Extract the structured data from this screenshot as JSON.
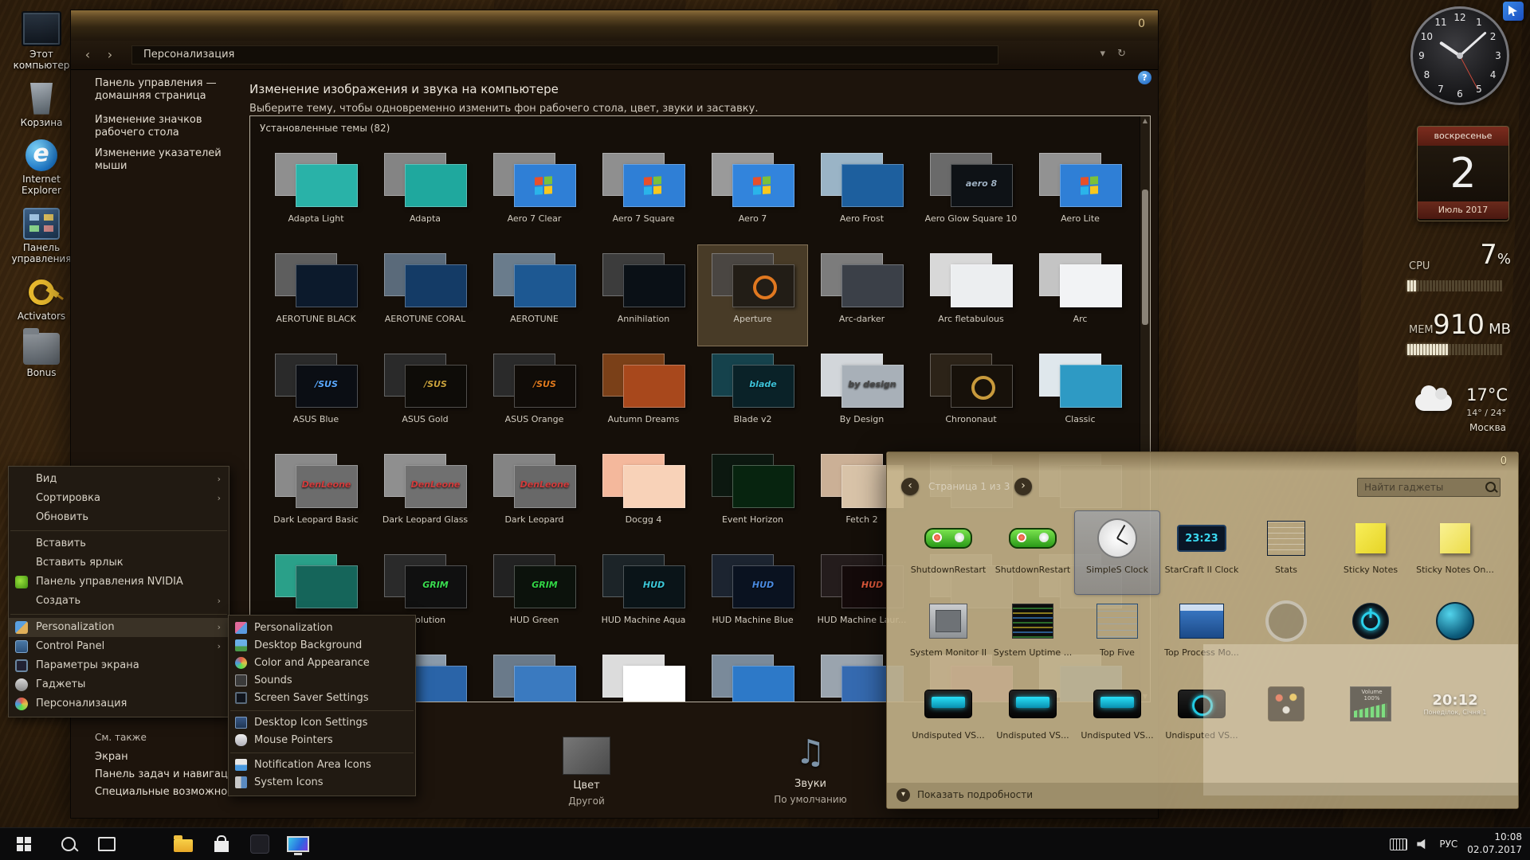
{
  "icons": {
    "back": "‹",
    "forward": "›",
    "dropdown": "▾",
    "refresh": "↻",
    "pager_prev": "‹",
    "pager_next": "›",
    "menu_arrow": "›",
    "expand": "▾",
    "scroll_up": "▲",
    "scroll_down": "▼"
  },
  "desktop_icons": [
    {
      "id": "computer",
      "label": "Этот компьютер"
    },
    {
      "id": "recycle",
      "label": "Корзина"
    },
    {
      "id": "ie",
      "label": "Internet Explorer"
    },
    {
      "id": "control",
      "label": "Панель управления"
    },
    {
      "id": "activators",
      "label": "Activators"
    },
    {
      "id": "bonus",
      "label": "Bonus"
    }
  ],
  "window": {
    "badge": "0",
    "help_badge": "?",
    "toolbar": {
      "address": "Персонализация"
    },
    "sidebar": {
      "home_lines": [
        "Панель управления —",
        "домашняя страница"
      ],
      "links": [
        "Изменение значков рабочего стола",
        "Изменение указателей мыши"
      ],
      "see_also_title": "См. также",
      "see_also": [
        "Экран",
        "Панель задач и навигация",
        "Специальные возможности"
      ]
    },
    "heading": "Изменение изображения и звука на компьютере",
    "subheading": "Выберите тему, чтобы одновременно изменить фон рабочего стола, цвет, звуки и заставку.",
    "themes_label": "Установленные темы (82)",
    "themes": [
      {
        "name": "Adapta Light",
        "back": "#8f8f8f",
        "front": "#29b2a8"
      },
      {
        "name": "Adapta",
        "back": "#848484",
        "front": "#1fa89e"
      },
      {
        "name": "Aero 7 Clear",
        "back": "#8a8a8a",
        "front": "#2f7fd6",
        "flag": true
      },
      {
        "name": "Aero 7 Square",
        "back": "#8f8f8f",
        "front": "#2f7fd6",
        "flag": true
      },
      {
        "name": "Aero 7",
        "back": "#9a9a9a",
        "front": "#3284dc",
        "flag": true
      },
      {
        "name": "Aero Frost",
        "back": "#9ab4c6",
        "front": "#1d5f9e"
      },
      {
        "name": "Aero Glow Square 10",
        "back": "#6a6a6a",
        "front": "#0e1216",
        "tag": "aero 8",
        "tagc": "#9fb2c4"
      },
      {
        "name": "Aero Lite",
        "back": "#929292",
        "front": "#2f7fd6",
        "flag": true
      },
      {
        "name": "AEROTUNE BLACK",
        "back": "#5e5e5e",
        "front": "#0c1a2c"
      },
      {
        "name": "AEROTUNE CORAL",
        "back": "#5a6a7a",
        "front": "#143b66"
      },
      {
        "name": "AEROTUNE",
        "back": "#6a7c8c",
        "front": "#1d5892"
      },
      {
        "name": "Annihilation",
        "back": "#3c3c3c",
        "front": "#0a1016"
      },
      {
        "name": "Aperture",
        "back": "#4a4642",
        "front": "#221d16",
        "ring": "#e07820",
        "selected": true
      },
      {
        "name": "Arc-darker",
        "back": "#7c7c7c",
        "front": "#3b4048"
      },
      {
        "name": "Arc fletabulous",
        "back": "#d8d8d8",
        "front": "#eceef0"
      },
      {
        "name": "Arc",
        "back": "#c4c4c4",
        "front": "#f2f3f5"
      },
      {
        "name": "ASUS Blue",
        "back": "#2a2a2a",
        "front": "#0b0e14",
        "tag": "/SUS",
        "tagc": "#5aa8ff"
      },
      {
        "name": "ASUS Gold",
        "back": "#2a2a2a",
        "front": "#0e0c08",
        "tag": "/SUS",
        "tagc": "#c9a23c"
      },
      {
        "name": "ASUS Orange",
        "back": "#2a2a2a",
        "front": "#100c08",
        "tag": "/SUS",
        "tagc": "#e07a1e"
      },
      {
        "name": "Autumn Dreams",
        "back": "#7a4018",
        "front": "#a8481c"
      },
      {
        "name": "Blade v2",
        "back": "#15424c",
        "front": "#0a2228",
        "tag": "blade",
        "tagc": "#3cc2d8"
      },
      {
        "name": "By Design",
        "back": "#d2d6da",
        "front": "#a8b0b8",
        "tag": "by design",
        "tagc": "#4a4a4a"
      },
      {
        "name": "Chrononaut",
        "back": "#2c2318",
        "front": "#17110a",
        "ring": "#c89a3c"
      },
      {
        "name": "Classic",
        "back": "#dfe7ec",
        "front": "#2e9ac4"
      },
      {
        "name": "Dark Leopard Basic",
        "back": "#8a8a8a",
        "front": "#6c6c6c",
        "tag": "DenLeone",
        "tagc": "#d23c3c"
      },
      {
        "name": "Dark Leopard Glass",
        "back": "#8f8f8f",
        "front": "#707070",
        "tag": "DenLeone",
        "tagc": "#d23c3c"
      },
      {
        "name": "Dark Leopard",
        "back": "#848484",
        "front": "#686868",
        "tag": "DenLeone",
        "tagc": "#d23c3c"
      },
      {
        "name": "Docgg 4",
        "back": "#f4b89c",
        "front": "#f8d2b8"
      },
      {
        "name": "Event Horizon",
        "back": "#0c1810",
        "front": "#07240f"
      },
      {
        "name": "Fetch 2",
        "back": "#cbb096",
        "front": "#d8c3a8"
      },
      {
        "name": "",
        "back": "#5a5a5a",
        "front": "#434343"
      },
      {
        "name": "",
        "back": "#5a5a5a",
        "front": "#434343"
      },
      {
        "name": "",
        "back": "#2aa089",
        "front": "#15655a"
      },
      {
        "name": "Evolution",
        "back": "#2a2a2a",
        "front": "#101010",
        "tag": "GRIM",
        "tagc": "#3adc50"
      },
      {
        "name": "HUD Green",
        "back": "#222222",
        "front": "#0c120c",
        "tag": "GRIM",
        "tagc": "#32d546"
      },
      {
        "name": "HUD Machine Aqua",
        "back": "#1c2428",
        "front": "#0a1418",
        "tag": "HUD",
        "tagc": "#3cc8d8"
      },
      {
        "name": "HUD Machine Blue",
        "back": "#1c2430",
        "front": "#0a1220",
        "tag": "HUD",
        "tagc": "#4a8ae0"
      },
      {
        "name": "HUD Machine Laur...",
        "back": "#241c1c",
        "front": "#140a0a",
        "tag": "HUD",
        "tagc": "#e05a3c"
      },
      {
        "name": "",
        "back": "#5a5a5a",
        "front": "#434343"
      },
      {
        "name": "",
        "back": "#5a5a5a",
        "front": "#434343"
      }
    ],
    "themes_partial": [
      {
        "back": "#7a8a9a",
        "front": "#2f6eb4"
      },
      {
        "back": "#8a9aaa",
        "front": "#2a64a8"
      },
      {
        "back": "#6a7a8a",
        "front": "#3a7ac0"
      },
      {
        "back": "#dcdcdc",
        "front": "#ffffff"
      },
      {
        "back": "#7a8a9a",
        "front": "#2d79c8"
      },
      {
        "back": "#9aa4ae",
        "front": "#356ab0"
      },
      {
        "back": "#9a7a8a",
        "front": "#b05a8a"
      },
      {
        "back": "#8a9aa4",
        "front": "#4a90d9"
      }
    ],
    "footer_items": [
      {
        "label": "Цвет",
        "value": "Другой",
        "icon": "color"
      },
      {
        "label": "Звуки",
        "value": "По умолчанию",
        "icon": "sound"
      }
    ]
  },
  "context_menu": {
    "items": [
      {
        "label": "Вид",
        "arrow": true
      },
      {
        "label": "Сортировка",
        "arrow": true
      },
      {
        "label": "Обновить",
        "sep_after": true
      },
      {
        "label": "Вставить"
      },
      {
        "label": "Вставить ярлык"
      },
      {
        "label": "Панель управления NVIDIA",
        "icon": "nvidia"
      },
      {
        "label": "Создать",
        "arrow": true,
        "sep_after": true
      },
      {
        "label": "Personalization",
        "arrow": true,
        "icon": "pers",
        "highlight": true
      },
      {
        "label": "Control Panel",
        "arrow": true,
        "icon": "cp"
      },
      {
        "label": "Параметры экрана",
        "icon": "display"
      },
      {
        "label": "Гаджеты",
        "icon": "gadgets"
      },
      {
        "label": "Персонализация",
        "icon": "paint"
      }
    ]
  },
  "submenu": {
    "items": [
      {
        "label": "Personalization",
        "icon": "pers"
      },
      {
        "label": "Desktop Background",
        "icon": "bg"
      },
      {
        "label": "Color and Appearance",
        "icon": "color"
      },
      {
        "label": "Sounds",
        "icon": "sound"
      },
      {
        "label": "Screen Saver Settings",
        "icon": "saver",
        "sep_after": true
      },
      {
        "label": "Desktop Icon Settings",
        "icon": "deskicons"
      },
      {
        "label": "Mouse Pointers",
        "icon": "mouse",
        "sep_after": true
      },
      {
        "label": "Notification Area Icons",
        "icon": "notif"
      },
      {
        "label": "System Icons",
        "icon": "sysicons"
      }
    ]
  },
  "gadgets_window": {
    "badge": "0",
    "pager": "Страница 1 из 3",
    "search_placeholder": "Найти гаджеты",
    "footer": "Показать подробности",
    "gadgets": [
      {
        "type": "shutdown",
        "label": "ShutdownRestart"
      },
      {
        "type": "shutdown",
        "label": "ShutdownRestart"
      },
      {
        "type": "clock-simple",
        "label": "SimpleS Clock",
        "selected": true
      },
      {
        "type": "sc2",
        "label": "StarCraft II Clock",
        "text": "23:23"
      },
      {
        "type": "stats",
        "label": "Stats"
      },
      {
        "type": "note",
        "label": "Sticky Notes"
      },
      {
        "type": "note2",
        "label": "Sticky Notes On..."
      },
      {
        "type": "chip",
        "label": "System Monitor II"
      },
      {
        "type": "uptime",
        "label": "System Uptime ..."
      },
      {
        "type": "topfive",
        "label": "Top Five"
      },
      {
        "type": "topproc",
        "label": "Top Process Mo..."
      },
      {
        "type": "clock-gray",
        "label": ""
      },
      {
        "type": "power",
        "label": ""
      },
      {
        "type": "globe",
        "label": ""
      },
      {
        "type": "vs",
        "label": "Undisputed VS..."
      },
      {
        "type": "vs",
        "label": "Undisputed VS..."
      },
      {
        "type": "vs",
        "label": "Undisputed VS..."
      },
      {
        "type": "vs-wifi",
        "label": "Undisputed VS..."
      },
      {
        "type": "tools",
        "label": ""
      },
      {
        "type": "volume",
        "label": "",
        "text": "Volume 100%"
      },
      {
        "type": "vs-clock",
        "label": "",
        "text": "20:12",
        "sub": "Понеділок, Січня 1"
      }
    ]
  },
  "side_gadgets": {
    "clock_numbers": [
      "12",
      "1",
      "2",
      "3",
      "4",
      "5",
      "6",
      "7",
      "8",
      "9",
      "10",
      "11"
    ],
    "calendar": {
      "weekday": "воскресенье",
      "day": "2",
      "month": "Июль 2017"
    },
    "cpu": {
      "label": "CPU",
      "value": "7",
      "unit": "%",
      "lit": 3,
      "total": 30
    },
    "mem": {
      "label": "MEM",
      "value": "910",
      "unit": "MB",
      "lit": 13,
      "total": 30
    },
    "weather": {
      "temp": "17°C",
      "range": "14° / 24°",
      "city": "Москва"
    }
  },
  "taskbar": {
    "icons": [
      {
        "id": "start"
      },
      {
        "id": "search"
      },
      {
        "id": "taskview"
      },
      {
        "id": "edge"
      },
      {
        "id": "explorer"
      },
      {
        "id": "store"
      },
      {
        "id": "app-dark"
      },
      {
        "id": "app-display"
      }
    ],
    "tray": {
      "lang": "РУС",
      "time": "10:08",
      "date": "02.07.2017"
    }
  }
}
